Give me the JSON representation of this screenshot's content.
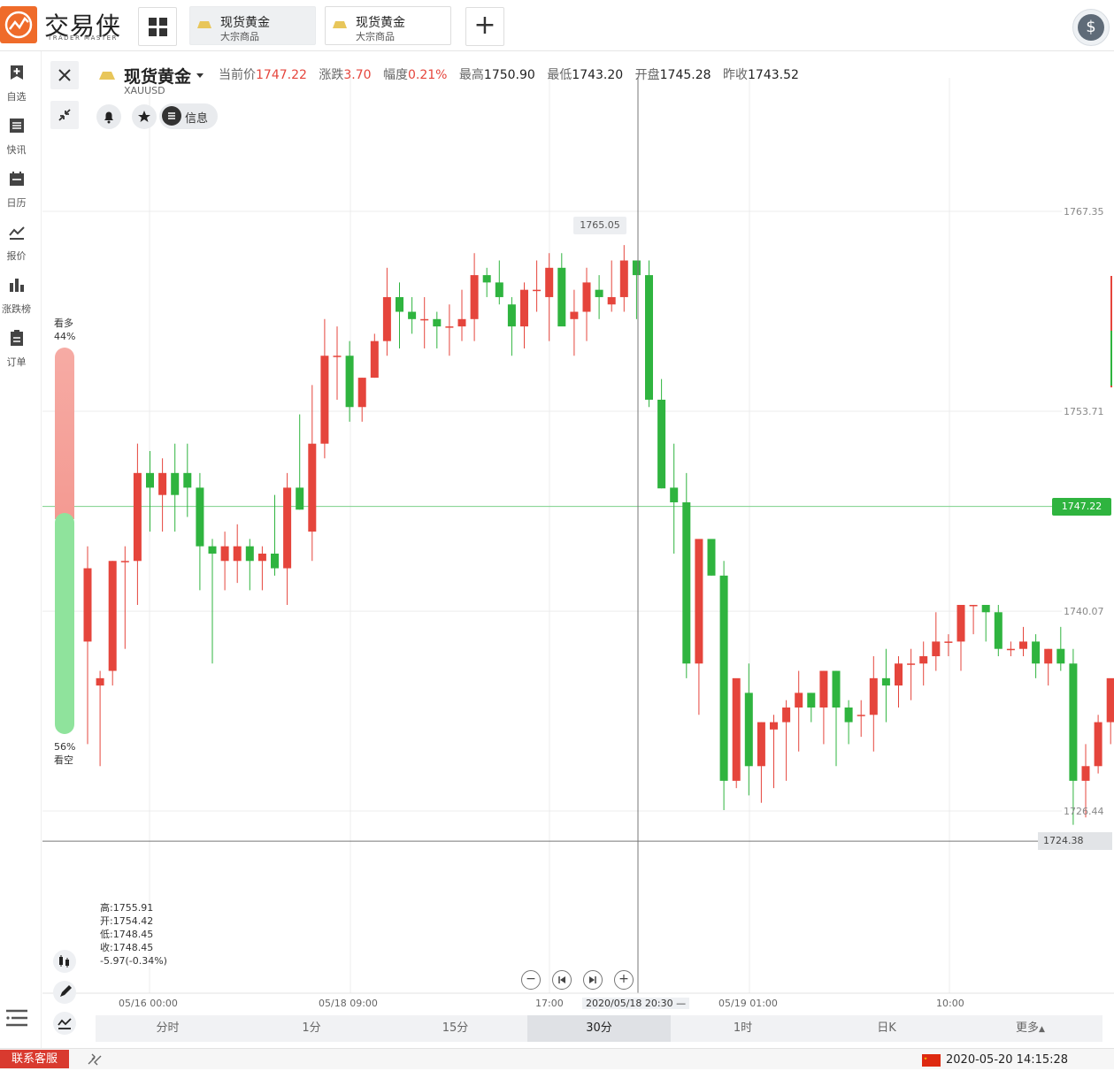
{
  "app": {
    "logo_text": "交易侠",
    "logo_sub": "TRADER MASTER"
  },
  "tabs": [
    {
      "title": "现货黄金",
      "subtitle": "大宗商品",
      "active": true
    },
    {
      "title": "现货黄金",
      "subtitle": "大宗商品",
      "active": false
    }
  ],
  "sidebar": {
    "items": [
      {
        "label": "自选",
        "icon": "bookmark-add-icon"
      },
      {
        "label": "快讯",
        "icon": "news-list-icon"
      },
      {
        "label": "日历",
        "icon": "calendar-icon"
      },
      {
        "label": "报价",
        "icon": "line-chart-icon"
      },
      {
        "label": "涨跌榜",
        "icon": "bar-chart-icon"
      },
      {
        "label": "订单",
        "icon": "clipboard-icon"
      }
    ]
  },
  "symbol": {
    "name": "现货黄金",
    "code": "XAUUSD",
    "quotes": [
      {
        "label": "当前价",
        "value": "1747.22",
        "color": "up"
      },
      {
        "label": "涨跌",
        "value": "3.70",
        "color": "up"
      },
      {
        "label": "幅度",
        "value": "0.21%",
        "color": "up"
      },
      {
        "label": "最高",
        "value": "1750.90",
        "color": "normal"
      },
      {
        "label": "最低",
        "value": "1743.20",
        "color": "normal"
      },
      {
        "label": "开盘",
        "value": "1745.28",
        "color": "normal"
      },
      {
        "label": "昨收",
        "value": "1743.52",
        "color": "normal"
      }
    ],
    "info_label": "信息"
  },
  "sentiment": {
    "bull_label": "看多",
    "bull_pct": "44%",
    "bear_label": "看空",
    "bear_pct": "56%",
    "bull_value": 0.44,
    "bear_value": 0.56
  },
  "ohlc_readout": {
    "high": "高:1755.91",
    "open": "开:1754.42",
    "low": "低:1748.45",
    "close": "收:1748.45",
    "change": "-5.97(-0.34%)"
  },
  "axis": {
    "y_ticks": [
      "1767.35",
      "1753.71",
      "1740.07",
      "1726.44"
    ],
    "x_ticks": [
      "05/16 00:00",
      "05/18 09:00",
      "17:00",
      "05/19 01:00",
      "10:00"
    ],
    "crosshair_time": "2020/05/18 20:30",
    "crosshair_price": "1724.38",
    "current_price_tag": "1747.22",
    "high_marker": "1765.05"
  },
  "periods": [
    "分时",
    "1分",
    "15分",
    "30分",
    "1时",
    "日K",
    "更多"
  ],
  "active_period": "30分",
  "footer": {
    "support_label": "联系客服",
    "datetime": "2020-05-20 14:15:28"
  },
  "colors": {
    "up": "#e5453c",
    "down": "#2fb43f",
    "accent": "#ef6b2a"
  },
  "chart_data": {
    "type": "candlestick",
    "symbol": "XAUUSD",
    "interval": "30分",
    "ylim": [
      1719,
      1775
    ],
    "y_ticks": [
      1767.35,
      1753.71,
      1740.07,
      1726.44
    ],
    "current_price": 1747.22,
    "candles": [
      [
        1738.0,
        1744.5,
        1731.0,
        1743.0
      ],
      [
        1735.0,
        1736.0,
        1729.5,
        1735.5
      ],
      [
        1736.0,
        1743.5,
        1735.0,
        1743.5
      ],
      [
        1743.5,
        1744.5,
        1737.5,
        1743.5
      ],
      [
        1743.5,
        1751.5,
        1740.5,
        1749.5
      ],
      [
        1749.5,
        1751.0,
        1745.5,
        1748.5
      ],
      [
        1748.0,
        1750.5,
        1745.5,
        1749.5
      ],
      [
        1749.5,
        1751.5,
        1745.5,
        1748.0
      ],
      [
        1749.5,
        1751.5,
        1746.5,
        1748.5
      ],
      [
        1748.5,
        1749.5,
        1741.5,
        1744.5
      ],
      [
        1744.5,
        1745.0,
        1736.5,
        1744.0
      ],
      [
        1743.5,
        1745.5,
        1741.5,
        1744.5
      ],
      [
        1743.5,
        1746.0,
        1742.0,
        1744.5
      ],
      [
        1744.5,
        1745.0,
        1741.5,
        1743.5
      ],
      [
        1743.5,
        1744.5,
        1741.5,
        1744.0
      ],
      [
        1744.0,
        1748.0,
        1742.5,
        1743.0
      ],
      [
        1743.0,
        1749.5,
        1740.5,
        1748.5
      ],
      [
        1748.5,
        1753.5,
        1747.0,
        1747.0
      ],
      [
        1745.5,
        1755.5,
        1743.5,
        1751.5
      ],
      [
        1751.5,
        1760.0,
        1750.5,
        1757.5
      ],
      [
        1757.5,
        1759.5,
        1754.5,
        1757.5
      ],
      [
        1757.5,
        1758.5,
        1753.0,
        1754.0
      ],
      [
        1754.0,
        1756.0,
        1753.0,
        1756.0
      ],
      [
        1756.0,
        1759.0,
        1756.0,
        1758.5
      ],
      [
        1758.5,
        1763.5,
        1757.5,
        1761.5
      ],
      [
        1761.5,
        1762.5,
        1758.0,
        1760.5
      ],
      [
        1760.5,
        1761.5,
        1759.0,
        1760.0
      ],
      [
        1760.0,
        1761.5,
        1758.0,
        1760.0
      ],
      [
        1760.0,
        1760.5,
        1758.0,
        1759.5
      ],
      [
        1759.5,
        1761.0,
        1757.5,
        1759.5
      ],
      [
        1759.5,
        1762.0,
        1758.5,
        1760.0
      ],
      [
        1760.0,
        1764.5,
        1758.5,
        1763.0
      ],
      [
        1763.0,
        1763.5,
        1761.5,
        1762.5
      ],
      [
        1762.5,
        1764.0,
        1761.0,
        1761.5
      ],
      [
        1761.0,
        1761.5,
        1757.5,
        1759.5
      ],
      [
        1759.5,
        1762.5,
        1758.0,
        1762.0
      ],
      [
        1762.0,
        1764.0,
        1760.5,
        1762.0
      ],
      [
        1761.5,
        1764.5,
        1758.5,
        1763.5
      ],
      [
        1763.5,
        1764.5,
        1760.5,
        1759.5
      ],
      [
        1760.0,
        1762.0,
        1757.5,
        1760.5
      ],
      [
        1760.5,
        1763.5,
        1758.5,
        1762.5
      ],
      [
        1762.0,
        1763.0,
        1760.0,
        1761.5
      ],
      [
        1761.0,
        1764.0,
        1760.5,
        1761.5
      ],
      [
        1761.5,
        1765.05,
        1760.5,
        1764.0
      ],
      [
        1764.0,
        1764.0,
        1760.0,
        1763.0
      ],
      [
        1763.0,
        1764.0,
        1754.0,
        1754.5
      ],
      [
        1754.5,
        1755.91,
        1748.45,
        1748.45
      ],
      [
        1748.5,
        1751.5,
        1744.0,
        1747.5
      ],
      [
        1747.5,
        1749.5,
        1735.5,
        1736.5
      ],
      [
        1736.5,
        1744.0,
        1733.0,
        1745.0
      ],
      [
        1745.0,
        1744.5,
        1742.5,
        1742.5
      ],
      [
        1742.5,
        1743.5,
        1726.5,
        1728.5
      ],
      [
        1728.5,
        1734.5,
        1728.0,
        1735.5
      ],
      [
        1734.5,
        1736.5,
        1727.5,
        1729.5
      ],
      [
        1729.5,
        1732.5,
        1727.0,
        1732.5
      ],
      [
        1732.0,
        1733.0,
        1728.0,
        1732.5
      ],
      [
        1732.5,
        1734.0,
        1728.5,
        1733.5
      ],
      [
        1733.5,
        1736.0,
        1730.5,
        1734.5
      ],
      [
        1734.5,
        1734.5,
        1732.5,
        1733.5
      ],
      [
        1733.5,
        1736.0,
        1731.0,
        1736.0
      ],
      [
        1736.0,
        1736.0,
        1729.5,
        1733.5
      ],
      [
        1733.5,
        1734.0,
        1731.0,
        1732.5
      ],
      [
        1733.0,
        1734.0,
        1731.5,
        1733.0
      ],
      [
        1733.0,
        1737.0,
        1730.5,
        1735.5
      ],
      [
        1735.5,
        1737.5,
        1732.5,
        1735.0
      ],
      [
        1735.0,
        1737.0,
        1733.5,
        1736.5
      ],
      [
        1736.5,
        1737.5,
        1734.0,
        1736.5
      ],
      [
        1736.5,
        1738.0,
        1735.0,
        1737.0
      ],
      [
        1737.0,
        1740.0,
        1736.0,
        1738.0
      ],
      [
        1738.0,
        1738.5,
        1737.0,
        1738.0
      ],
      [
        1738.0,
        1740.5,
        1736.0,
        1740.5
      ],
      [
        1740.5,
        1740.5,
        1738.5,
        1740.5
      ],
      [
        1740.5,
        1740.5,
        1738.0,
        1740.0
      ],
      [
        1740.0,
        1740.5,
        1737.0,
        1737.5
      ],
      [
        1737.5,
        1738.0,
        1737.0,
        1737.5
      ],
      [
        1737.5,
        1739.0,
        1737.0,
        1738.0
      ],
      [
        1738.0,
        1738.5,
        1735.5,
        1736.5
      ],
      [
        1736.5,
        1737.5,
        1735.0,
        1737.5
      ],
      [
        1737.5,
        1739.0,
        1736.0,
        1736.5
      ],
      [
        1736.5,
        1737.5,
        1725.5,
        1728.5
      ],
      [
        1728.5,
        1731.0,
        1726.0,
        1729.5
      ],
      [
        1729.5,
        1733.0,
        1729.0,
        1732.5
      ],
      [
        1732.5,
        1735.0,
        1731.0,
        1735.5
      ]
    ]
  }
}
